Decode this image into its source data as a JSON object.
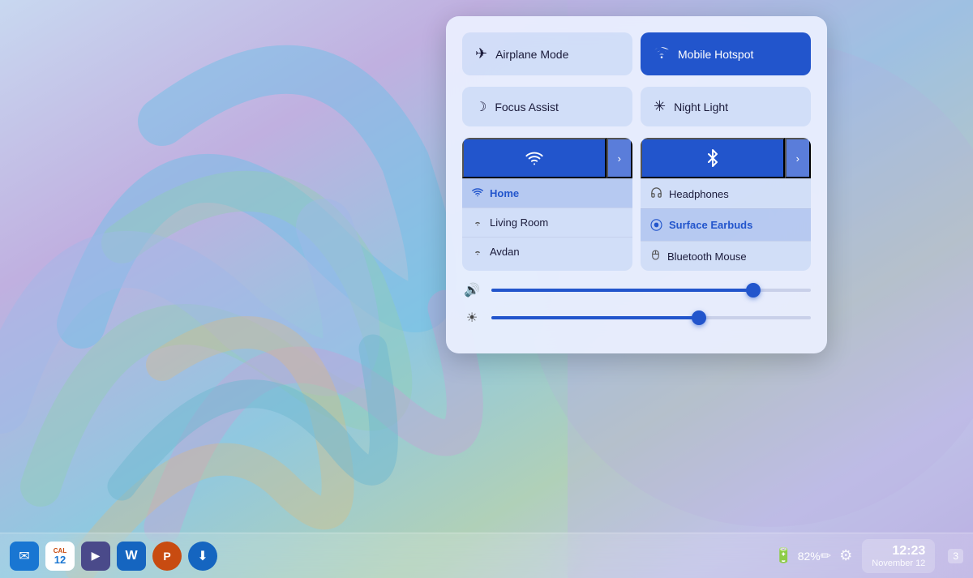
{
  "wallpaper": {
    "description": "Colorful abstract swirl wallpaper with blues, purples, greens"
  },
  "quickSettings": {
    "tiles": [
      {
        "id": "airplane-mode",
        "label": "Airplane Mode",
        "icon": "✈",
        "active": false
      },
      {
        "id": "mobile-hotspot",
        "label": "Mobile Hotspot",
        "icon": "📶",
        "active": true
      }
    ],
    "tiles2": [
      {
        "id": "focus-assist",
        "label": "Focus Assist",
        "icon": "☽",
        "active": false
      },
      {
        "id": "night-light",
        "label": "Night Light",
        "icon": "✳",
        "active": false
      }
    ],
    "wifi": {
      "icon": "wifi",
      "arrowLabel": "›",
      "networks": [
        {
          "id": "home",
          "label": "Home",
          "icon": "wifi",
          "active": true
        },
        {
          "id": "living-room",
          "label": "Living Room",
          "icon": "wifi-weak",
          "active": false
        },
        {
          "id": "avdan",
          "label": "Avdan",
          "icon": "wifi-weak",
          "active": false
        }
      ]
    },
    "bluetooth": {
      "icon": "bluetooth",
      "arrowLabel": "›",
      "devices": [
        {
          "id": "headphones",
          "label": "Headphones",
          "icon": "headphones",
          "active": false
        },
        {
          "id": "surface-earbuds",
          "label": "Surface Earbuds",
          "icon": "earbuds",
          "active": true
        },
        {
          "id": "bluetooth-mouse",
          "label": "Bluetooth Mouse",
          "icon": "mouse",
          "active": false
        }
      ]
    },
    "volume": {
      "icon": "🔊",
      "value": 82,
      "percent": 82
    },
    "brightness": {
      "icon": "☀",
      "value": 65,
      "percent": 65
    }
  },
  "taskbar": {
    "icons": [
      {
        "id": "mail",
        "label": "Mail",
        "emoji": "✉",
        "bgColor": "#1976d2",
        "color": "white"
      },
      {
        "id": "calendar",
        "label": "Calendar",
        "num": "12",
        "bgColor": "white",
        "color": "#1976d2"
      },
      {
        "id": "media",
        "label": "Media Player",
        "emoji": "▶",
        "bgColor": "#4a4a8a",
        "color": "white"
      },
      {
        "id": "word",
        "label": "Word",
        "emoji": "W",
        "bgColor": "#1565c0",
        "color": "white"
      },
      {
        "id": "powerpoint",
        "label": "PowerPoint",
        "emoji": "P",
        "bgColor": "#c84b11",
        "color": "white"
      },
      {
        "id": "download",
        "label": "Downloader",
        "emoji": "⬇",
        "bgColor": "#1565c0",
        "color": "white"
      }
    ],
    "battery": {
      "icon": "🔋",
      "percent": "82%"
    },
    "systemIcons": [
      {
        "id": "pen",
        "icon": "✏"
      },
      {
        "id": "settings",
        "icon": "⚙"
      }
    ],
    "clock": {
      "time": "12:23",
      "date": "November 12"
    },
    "notification": "3"
  }
}
